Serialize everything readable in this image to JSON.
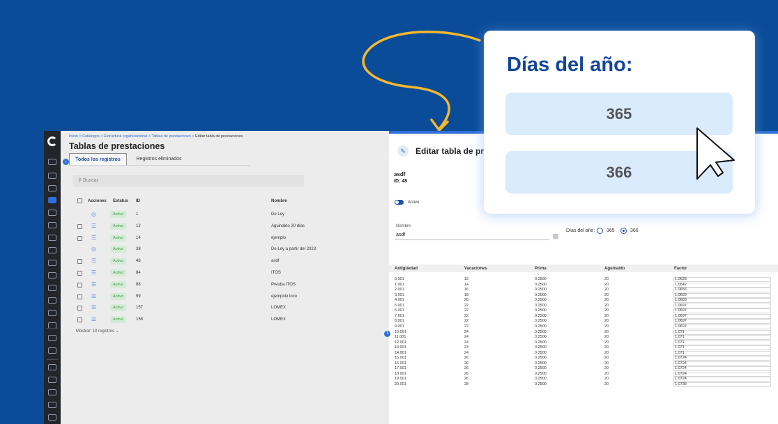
{
  "colors": {
    "background": "#0a4c98",
    "accent": "#2f6fd6",
    "status_green": "#3f9a4c",
    "callout_title": "#12469a"
  },
  "breadcrumb": {
    "parts": [
      "Inicio",
      "Catálogos",
      "Estructura organizacional",
      "Tablas de prestaciones",
      "Editar tabla de prestaciones"
    ],
    "sep": ">"
  },
  "list": {
    "title": "Tablas de prestaciones",
    "tabs": [
      "Todos los registros",
      "Registros eliminados"
    ],
    "search_placeholder": "Buscar",
    "columns": [
      "Acciones",
      "Estatus",
      "ID",
      "Nombre"
    ],
    "rows": [
      {
        "status": "Activo",
        "id": "1",
        "name": "De Ley",
        "checkbox": false,
        "action_icon": "eye-icon"
      },
      {
        "status": "Activo",
        "id": "12",
        "name": "Aguinaldo 20 días",
        "checkbox": true,
        "action_icon": "layers-icon"
      },
      {
        "status": "Activo",
        "id": "14",
        "name": "ejemplo",
        "checkbox": true,
        "action_icon": "layers-icon"
      },
      {
        "status": "Activo",
        "id": "38",
        "name": "De Ley a partir del 2023",
        "checkbox": false,
        "action_icon": "eye-icon"
      },
      {
        "status": "Activo",
        "id": "48",
        "name": "asdf",
        "checkbox": true,
        "action_icon": "layers-icon"
      },
      {
        "status": "Activo",
        "id": "84",
        "name": "ITOS",
        "checkbox": true,
        "action_icon": "layers-icon"
      },
      {
        "status": "Activo",
        "id": "88",
        "name": "Preuba ITOS",
        "checkbox": true,
        "action_icon": "layers-icon"
      },
      {
        "status": "Activo",
        "id": "99",
        "name": "ejempolo loco",
        "checkbox": true,
        "action_icon": "layers-icon"
      },
      {
        "status": "Activo",
        "id": "157",
        "name": "LOMEX",
        "checkbox": true,
        "action_icon": "layers-icon"
      },
      {
        "status": "Activo",
        "id": "158",
        "name": "LOMEX",
        "checkbox": true,
        "action_icon": "layers-icon"
      }
    ],
    "show_label": "Mostrar: 10 registros",
    "collapse_glyph": "›"
  },
  "edit": {
    "title": "Editar tabla de pr",
    "record_name": "asdf",
    "record_id": "ID: 48",
    "toggle_label": "Activo",
    "name_label": "Nombre",
    "name_value": "asdf",
    "days_label": "Días del año:",
    "days_options": [
      "365",
      "366"
    ],
    "days_selected": "366",
    "grid_columns": [
      "Antigüedad",
      "Vacaciones",
      "Prima",
      "Aguinaldo",
      "Factor"
    ],
    "grid_rows": [
      [
        "0.001",
        "12",
        "0.2500",
        "20",
        "1.0628"
      ],
      [
        "1.001",
        "14",
        "0.2500",
        "20",
        "1.0642"
      ],
      [
        "2.001",
        "16",
        "0.2500",
        "20",
        "1.0656"
      ],
      [
        "3.001",
        "18",
        "0.2500",
        "20",
        "1.0669"
      ],
      [
        "4.001",
        "20",
        "0.2500",
        "20",
        "1.0683"
      ],
      [
        "5.001",
        "22",
        "0.2500",
        "20",
        "1.0697"
      ],
      [
        "6.001",
        "22",
        "0.2500",
        "20",
        "1.0697"
      ],
      [
        "7.001",
        "22",
        "0.2500",
        "20",
        "1.0697"
      ],
      [
        "8.001",
        "22",
        "0.2500",
        "20",
        "1.0697"
      ],
      [
        "9.001",
        "22",
        "0.2500",
        "20",
        "1.0697"
      ],
      [
        "10.001",
        "24",
        "0.2500",
        "20",
        "1.071"
      ],
      [
        "11.001",
        "24",
        "0.2500",
        "20",
        "1.071"
      ],
      [
        "12.001",
        "24",
        "0.2500",
        "20",
        "1.071"
      ],
      [
        "13.001",
        "24",
        "0.2500",
        "20",
        "1.071"
      ],
      [
        "14.001",
        "24",
        "0.2500",
        "20",
        "1.071"
      ],
      [
        "15.001",
        "26",
        "0.2500",
        "20",
        "1.0724"
      ],
      [
        "16.001",
        "26",
        "0.2500",
        "20",
        "1.0724"
      ],
      [
        "17.001",
        "26",
        "0.2500",
        "20",
        "1.0724"
      ],
      [
        "18.001",
        "26",
        "0.2500",
        "20",
        "1.0724"
      ],
      [
        "19.001",
        "26",
        "0.2500",
        "20",
        "1.0724"
      ],
      [
        "20.001",
        "28",
        "0.2500",
        "20",
        "1.0738"
      ]
    ],
    "badge_count": "1"
  },
  "callout": {
    "title": "Días del año:",
    "options": [
      "365",
      "366"
    ]
  }
}
